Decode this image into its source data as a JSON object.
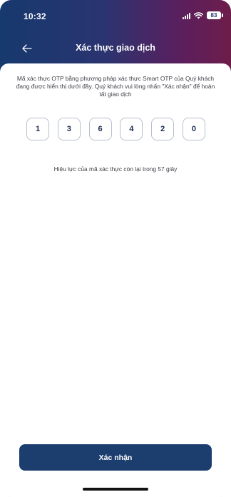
{
  "status_bar": {
    "time": "10:32",
    "battery": "83",
    "signal_icon": "signal-icon",
    "wifi_icon": "wifi-icon"
  },
  "header": {
    "title": "Xác thực giao dịch",
    "back_icon": "arrow-left-icon"
  },
  "main": {
    "instruction": "Mã xác thực OTP bằng phương pháp xác thực Smart OTP của Quý khách đang được hiển thị dưới đây. Quý khách vui lòng nhấn \"Xác nhận\" để hoàn tất giao dịch",
    "otp_digits": [
      "1",
      "3",
      "6",
      "4",
      "2",
      "0"
    ],
    "validity_text": "Hiệu lực của mã xác thực còn lại trong 57 giây"
  },
  "footer": {
    "confirm_label": "Xác nhận"
  },
  "colors": {
    "header_start": "#16396e",
    "header_end": "#6d1d4a",
    "button_bg": "#1c3e6e",
    "otp_border": "#b8c0cc"
  }
}
